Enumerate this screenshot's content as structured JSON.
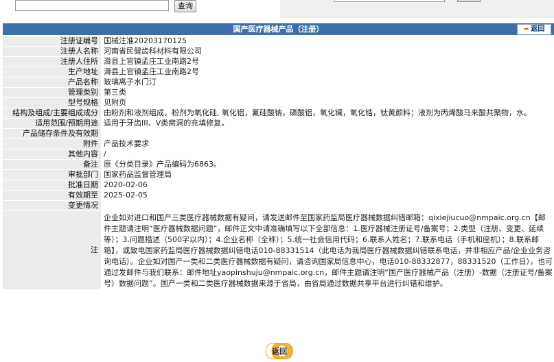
{
  "search": {
    "button_label": "查询",
    "value": ""
  },
  "header": {
    "title": "国产医疗器械产品（注册）",
    "back_label": "返回"
  },
  "fields": [
    {
      "label": "注册证编号",
      "value": "国械注准20203170125"
    },
    {
      "label": "注册人名称",
      "value": "河南省民健齿科材料有限公司"
    },
    {
      "label": "注册人住所",
      "value": "滑县上官镇孟庄工业南路2号"
    },
    {
      "label": "生产地址",
      "value": "滑县上官镇孟庄工业南路2号"
    },
    {
      "label": "产品名称",
      "value": "玻璃离子水门汀"
    },
    {
      "label": "管理类别",
      "value": "第三类"
    },
    {
      "label": "型号规格",
      "value": "见附页"
    },
    {
      "label": "结构及组成/主要组成成分",
      "value": "由粉剂和液剂组成，粉剂为氧化硅, 氧化铝，氟硅酸钠，磷酸铝，氧化镧，氧化锆，钛黄颜料；液剂为丙烯酸马来酸共聚物，水。"
    },
    {
      "label": "适用范围/预期用途",
      "value": "适用于牙齿III、V类窝洞的充填修复。"
    },
    {
      "label": "产品储存条件及有效期",
      "value": ""
    },
    {
      "label": "附件",
      "value": "产品技术要求"
    },
    {
      "label": "其他内容",
      "value": "/"
    },
    {
      "label": "备注",
      "value": "原《分类目录》产品编码为6863。"
    },
    {
      "label": "审批部门",
      "value": "国家药品监督管理局"
    },
    {
      "label": "批准日期",
      "value": "2020-02-06"
    },
    {
      "label": "有效期至",
      "value": "2025-02-05"
    },
    {
      "label": "变更情况",
      "value": ""
    }
  ],
  "note": {
    "label": "注",
    "text": "企业如对进口和国产三类医疗器械数据有疑问，请发送邮件至国家药监局医疗器械数据纠错邮箱：qixiejiucuo@nmpaic.org.cn【邮件主题请注明“医疗器械数据问题”，邮件正文中请准确填写以下全部信息：1.医疗器械注册证号/备案号；2.类型（注册、变更、延续等）；3.问题描述（500字以内）；4.企业名称（全称）；5.统一社会信用代码；6.联系人姓名；7.联系电话（手机和座机）；8.联系邮箱】，或致电国家药监局医疗器械数据纠错电话010-88331514（此电话为我局医疗器械数据纠错联系电话，并非相应产品/企业业务咨询电话）。企业如对国产一类和二类医疗器械数据有疑问，请咨询国家局信息中心，电话010-88332877，88331520（工作日），也可通过发邮件与我们联系：邮件地址yaopinshuju@nmpaic.org.cn，邮件主题请注明“国产医疗器械产品（注册）-数据（注册证号/备案号）数据问题”。国产一类和二类医疗器械数据来源于省局，由省局通过数据共享平台进行纠错和维护。"
  },
  "footer": {
    "back_label": "返回"
  },
  "colors": {
    "header_bg": "#3f6fa8",
    "label_bg": "#ececec",
    "accent": "#f2b03a"
  }
}
